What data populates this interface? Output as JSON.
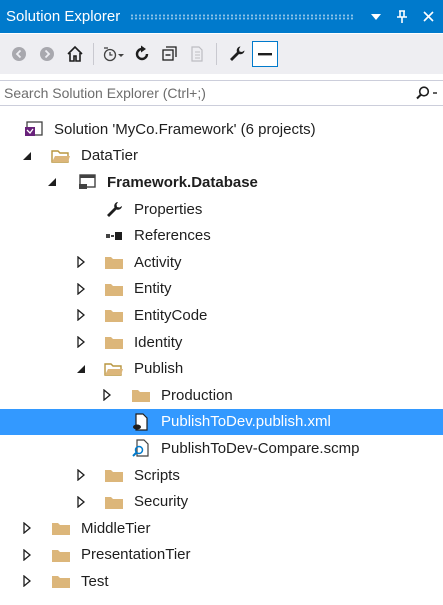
{
  "window": {
    "title": "Solution Explorer"
  },
  "search": {
    "placeholder": "Search Solution Explorer (Ctrl+;)"
  },
  "tree": {
    "solution": "Solution 'MyCo.Framework' (6 projects)",
    "datatier": "DataTier",
    "project": "Framework.Database",
    "properties": "Properties",
    "references": "References",
    "activity": "Activity",
    "entity": "Entity",
    "entitycode": "EntityCode",
    "identity": "Identity",
    "publish": "Publish",
    "production": "Production",
    "publish_xml": "PublishToDev.publish.xml",
    "compare": "PublishToDev-Compare.scmp",
    "scripts": "Scripts",
    "security": "Security",
    "middletier": "MiddleTier",
    "presentationtier": "PresentationTier",
    "test": "Test"
  },
  "colors": {
    "accent": "#007acc",
    "selection": "#3399ff",
    "folder": "#dcb67a",
    "toolbar_bg": "#eeeef2"
  }
}
